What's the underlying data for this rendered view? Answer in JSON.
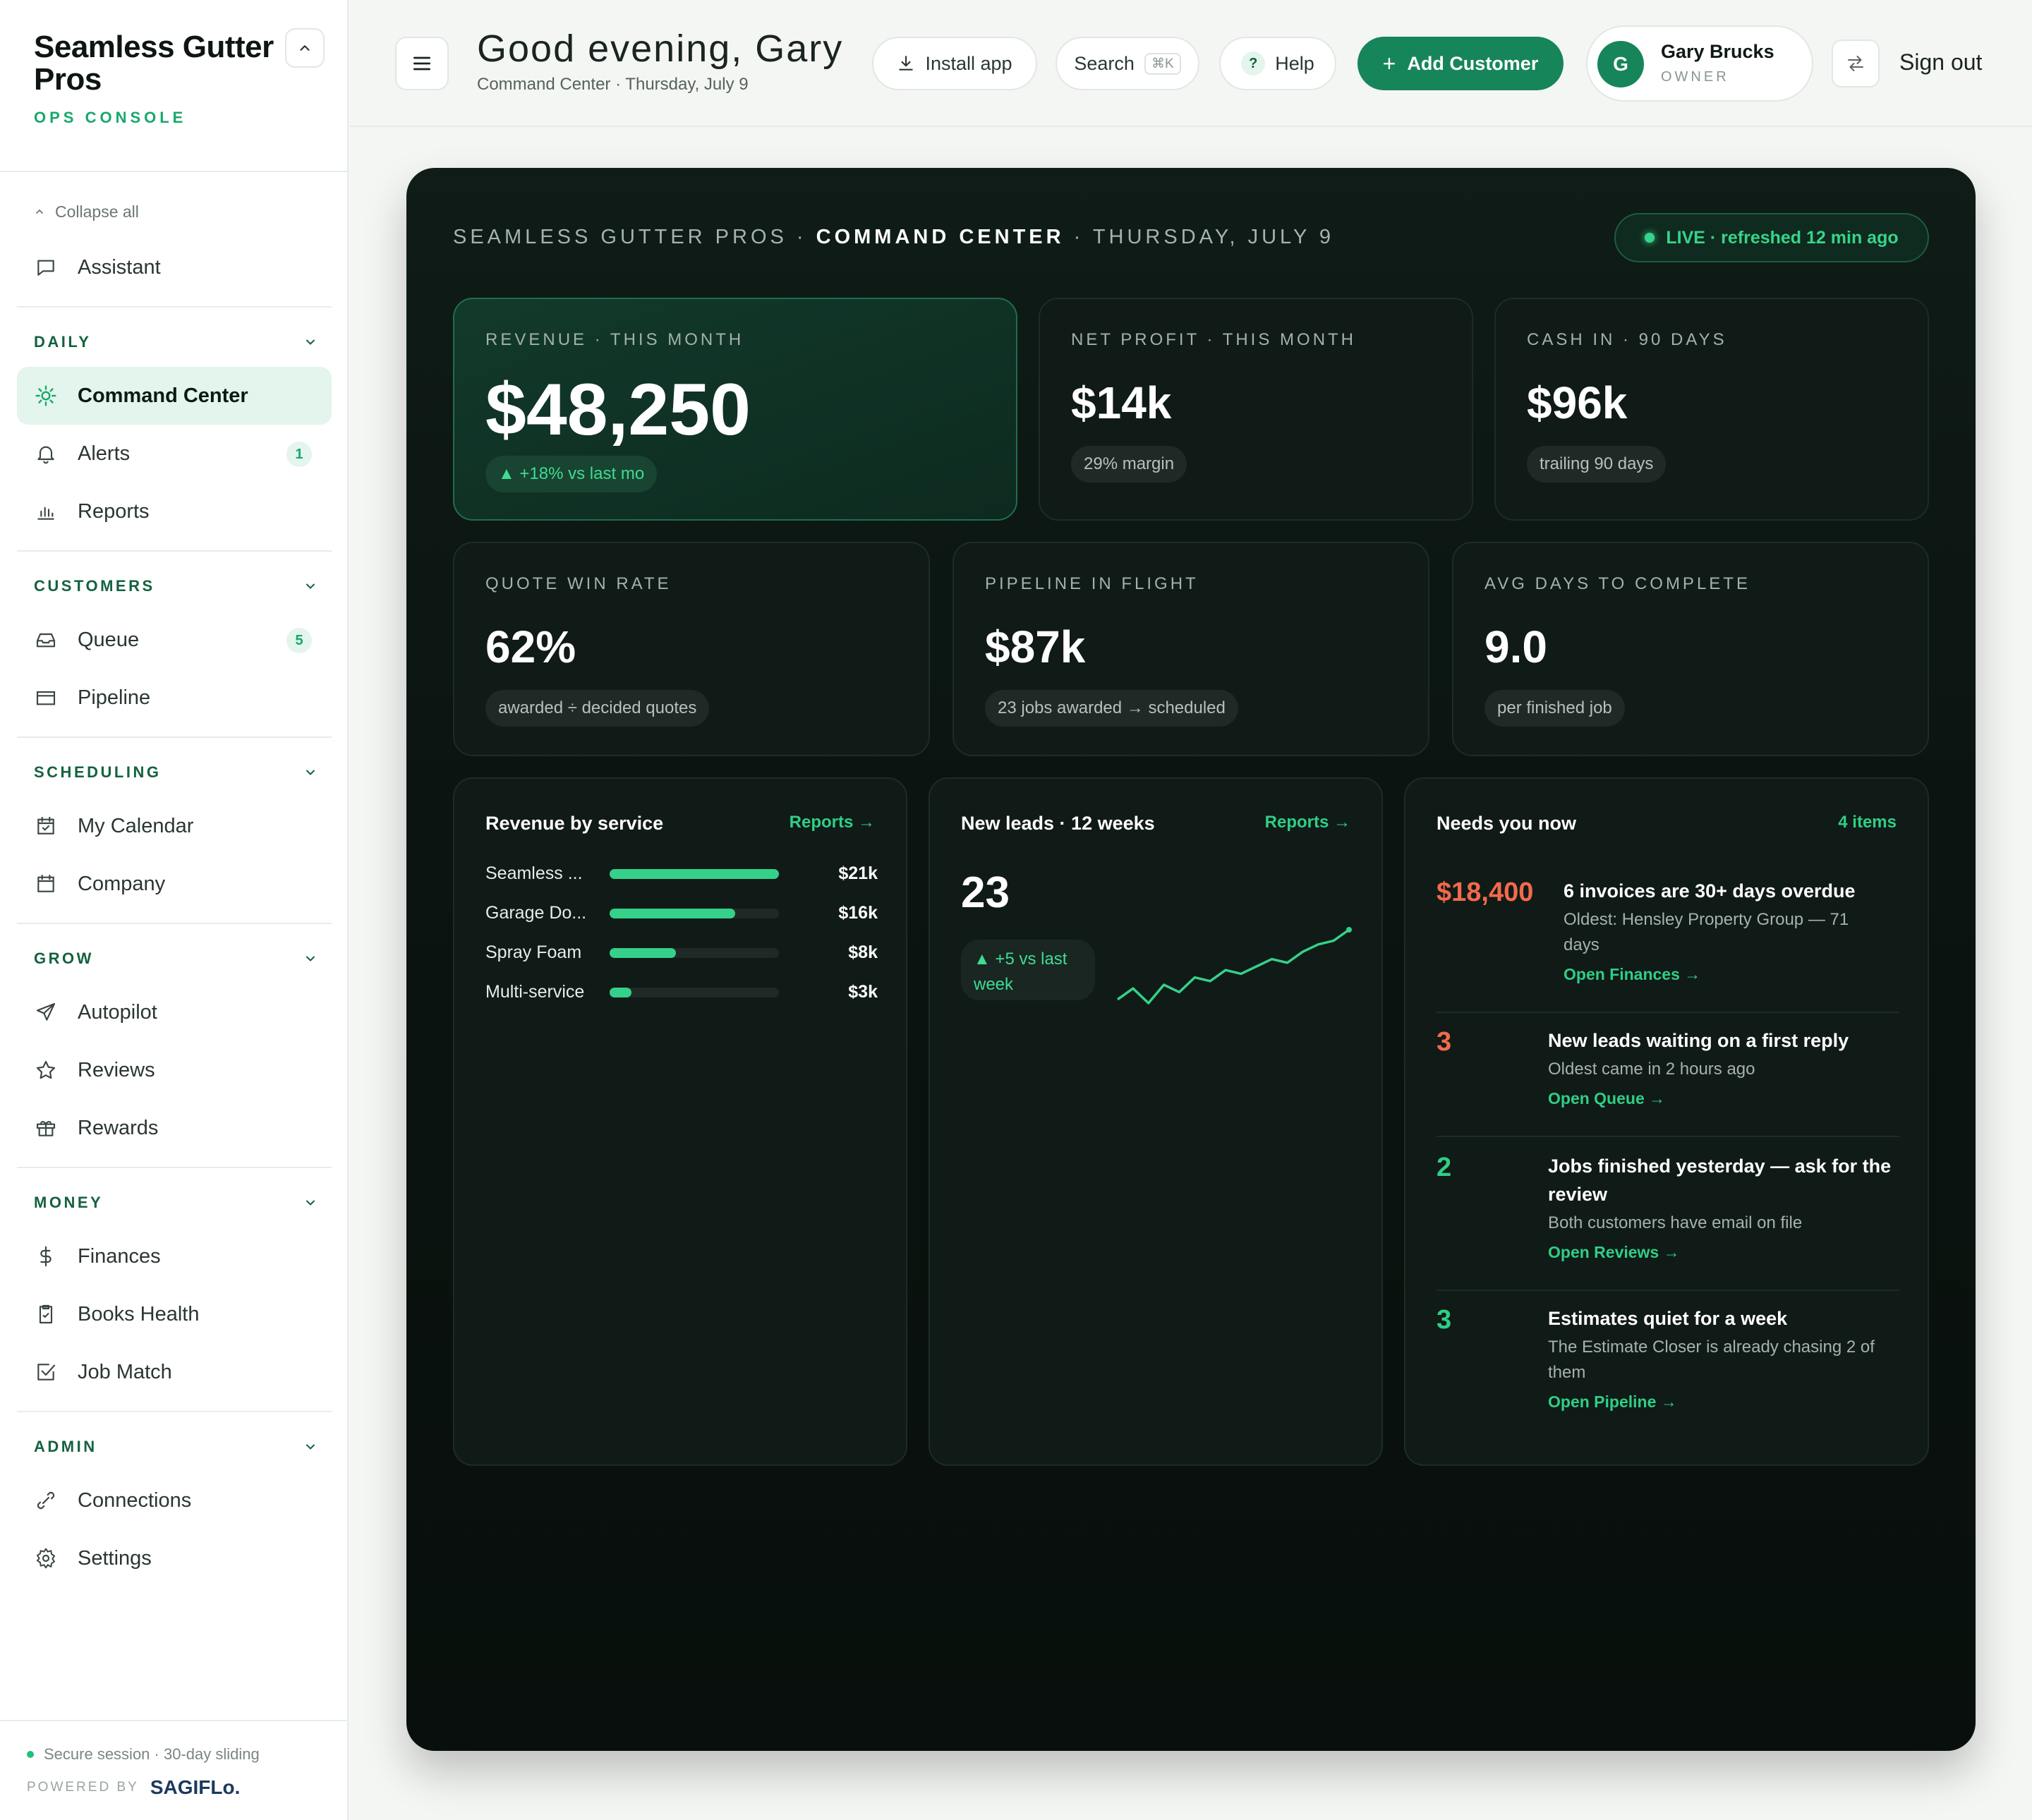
{
  "brand": {
    "name": "Seamless Gutter Pros",
    "subtitle": "OPS CONSOLE"
  },
  "sidebar": {
    "collapse_all": "Collapse all",
    "assistant": "Assistant",
    "sections": [
      {
        "title": "DAILY",
        "items": [
          {
            "label": "Command Center",
            "icon": "sun-icon",
            "active": true
          },
          {
            "label": "Alerts",
            "icon": "bell-icon",
            "badge": "1"
          },
          {
            "label": "Reports",
            "icon": "bar-chart-icon"
          }
        ]
      },
      {
        "title": "CUSTOMERS",
        "items": [
          {
            "label": "Queue",
            "icon": "inbox-icon",
            "badge": "5"
          },
          {
            "label": "Pipeline",
            "icon": "folder-icon"
          }
        ]
      },
      {
        "title": "SCHEDULING",
        "items": [
          {
            "label": "My Calendar",
            "icon": "calendar-check-icon"
          },
          {
            "label": "Company",
            "icon": "calendar-icon"
          }
        ]
      },
      {
        "title": "GROW",
        "items": [
          {
            "label": "Autopilot",
            "icon": "send-icon"
          },
          {
            "label": "Reviews",
            "icon": "star-icon"
          },
          {
            "label": "Rewards",
            "icon": "gift-icon"
          }
        ]
      },
      {
        "title": "MONEY",
        "items": [
          {
            "label": "Finances",
            "icon": "dollar-icon"
          },
          {
            "label": "Books Health",
            "icon": "clipboard-icon"
          },
          {
            "label": "Job Match",
            "icon": "check-square-icon"
          }
        ]
      },
      {
        "title": "ADMIN",
        "items": [
          {
            "label": "Connections",
            "icon": "link-icon"
          },
          {
            "label": "Settings",
            "icon": "gear-icon"
          }
        ]
      }
    ],
    "footer": {
      "secure": "Secure session · 30-day sliding",
      "powered_by": "POWERED BY",
      "logo": "SAGIFLo."
    }
  },
  "topbar": {
    "greeting": "Good evening, Gary",
    "subline": "Command Center · Thursday, July 9",
    "install": "Install app",
    "search": "Search",
    "search_kbd": "⌘K",
    "help": "Help",
    "add_customer": "Add Customer",
    "user": {
      "initial": "G",
      "name": "Gary Brucks",
      "role": "OWNER"
    },
    "sign_out": "Sign out"
  },
  "board": {
    "head_pre": "SEAMLESS GUTTER PROS · ",
    "head_bold": "COMMAND CENTER",
    "head_post": " · THURSDAY, JULY 9",
    "live": "LIVE · refreshed 12 min ago"
  },
  "kpis": {
    "revenue": {
      "label": "REVENUE · THIS MONTH",
      "value": "$48,250",
      "tag": "▲ +18% vs last mo"
    },
    "profit": {
      "label": "NET PROFIT · THIS MONTH",
      "value": "$14k",
      "tag": "29% margin"
    },
    "cash": {
      "label": "CASH IN · 90 DAYS",
      "value": "$96k",
      "tag": "trailing 90 days"
    },
    "winrate": {
      "label": "QUOTE WIN RATE",
      "value": "62%",
      "tag": "awarded ÷ decided quotes"
    },
    "pipeline": {
      "label": "PIPELINE IN FLIGHT",
      "value": "$87k",
      "tag": "23 jobs awarded → scheduled"
    },
    "avgdays": {
      "label": "AVG DAYS TO COMPLETE",
      "value": "9.0",
      "tag": "per finished job"
    }
  },
  "revenue_by_service": {
    "title": "Revenue by service",
    "link": "Reports →",
    "rows": [
      {
        "name": "Seamless ...",
        "value": "$21k",
        "fraction": 1.0
      },
      {
        "name": "Garage Do...",
        "value": "$16k",
        "fraction": 0.74
      },
      {
        "name": "Spray Foam",
        "value": "$8k",
        "fraction": 0.39
      },
      {
        "name": "Multi-service",
        "value": "$3k",
        "fraction": 0.13
      }
    ]
  },
  "new_leads": {
    "title": "New leads · 12 weeks",
    "link": "Reports →",
    "value": "23",
    "tag_line1": "▲ +5 vs last",
    "tag_line2": "week",
    "chart_data": {
      "type": "line",
      "x": [
        1,
        2,
        3,
        4,
        5,
        6,
        7,
        8,
        9,
        10,
        11,
        12,
        13,
        14,
        15,
        16
      ],
      "values": [
        6,
        9,
        5,
        10,
        8,
        12,
        11,
        14,
        13,
        15,
        17,
        16,
        19,
        21,
        22,
        25
      ],
      "color": "#35d08a"
    }
  },
  "needs": {
    "title": "Needs you now",
    "count": "4 items",
    "items": [
      {
        "num": "$18,400",
        "color": "#f26a4b",
        "title": "6 invoices are 30+ days overdue",
        "sub1": "Oldest: Hensley Property Group — 71",
        "sub2": "days",
        "link": "Open Finances →"
      },
      {
        "num": "3",
        "color": "#f26a4b",
        "title": "New leads waiting on a first reply",
        "sub1": "Oldest came in 2 hours ago",
        "link": "Open Queue →"
      },
      {
        "num": "2",
        "color": "#2fce85",
        "title1": "Jobs finished yesterday — ask for the",
        "title2": "review",
        "sub1": "Both customers have email on file",
        "link": "Open Reviews →"
      },
      {
        "num": "3",
        "color": "#2fce85",
        "title": "Estimates quiet for a week",
        "sub1": "The Estimate Closer is already chasing 2 of",
        "sub2": "them",
        "link": "Open Pipeline →"
      }
    ]
  },
  "colors": {
    "accent": "#17855a",
    "accent_bright": "#35d08a",
    "alert": "#f26a4b",
    "board_bg": "#0b1411"
  }
}
